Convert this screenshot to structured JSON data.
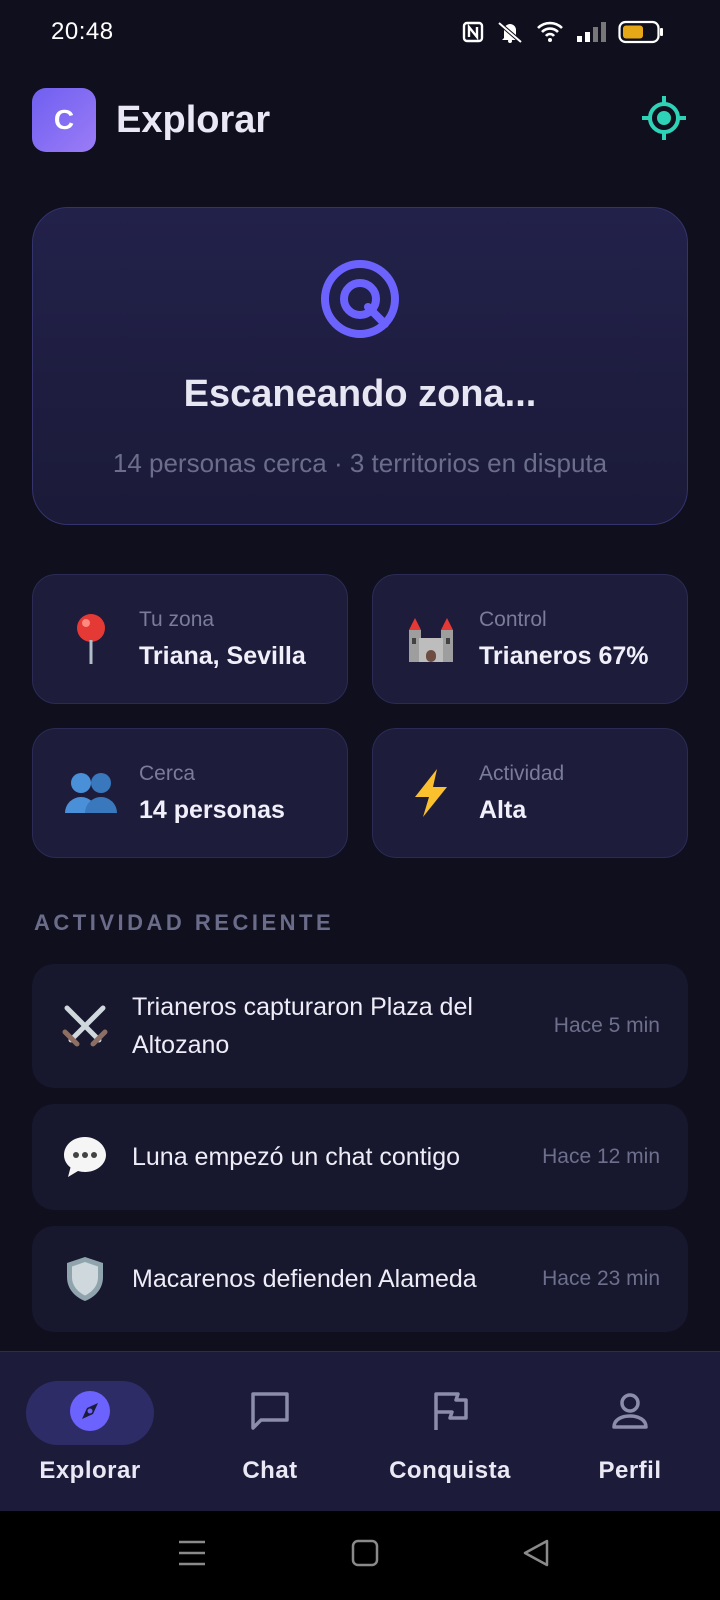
{
  "status_bar": {
    "time": "20:48"
  },
  "header": {
    "logo_letter": "C",
    "title": "Explorar"
  },
  "scan_card": {
    "title": "Escaneando zona...",
    "subtitle": "14 personas cerca · 3 territorios en disputa"
  },
  "stats": [
    {
      "icon": "pin-icon",
      "label": "Tu zona",
      "value": "Triana, Sevilla"
    },
    {
      "icon": "castle-icon",
      "label": "Control",
      "value": "Trianeros 67%"
    },
    {
      "icon": "people-icon",
      "label": "Cerca",
      "value": "14 personas"
    },
    {
      "icon": "lightning-icon",
      "label": "Actividad",
      "value": "Alta"
    }
  ],
  "recent": {
    "heading": "ACTIVIDAD RECIENTE",
    "items": [
      {
        "icon": "crossed-swords-icon",
        "text": "Trianeros capturaron Plaza del Altozano",
        "time": "Hace 5 min"
      },
      {
        "icon": "speech-bubble-icon",
        "text": "Luna empezó un chat contigo",
        "time": "Hace 12 min"
      },
      {
        "icon": "shield-icon",
        "text": "Macarenos defienden Alameda",
        "time": "Hace 23 min"
      }
    ]
  },
  "bottom_nav": {
    "items": [
      {
        "label": "Explorar",
        "icon": "compass-icon",
        "active": true
      },
      {
        "label": "Chat",
        "icon": "chat-icon",
        "active": false
      },
      {
        "label": "Conquista",
        "icon": "flag-icon",
        "active": false
      },
      {
        "label": "Perfil",
        "icon": "person-icon",
        "active": false
      }
    ]
  },
  "colors": {
    "background": "#0f0f1e",
    "card": "#1d1c3b",
    "accent": "#6c63ff",
    "locate_accent": "#2ed3b7",
    "muted_text": "#6b6d8a"
  }
}
